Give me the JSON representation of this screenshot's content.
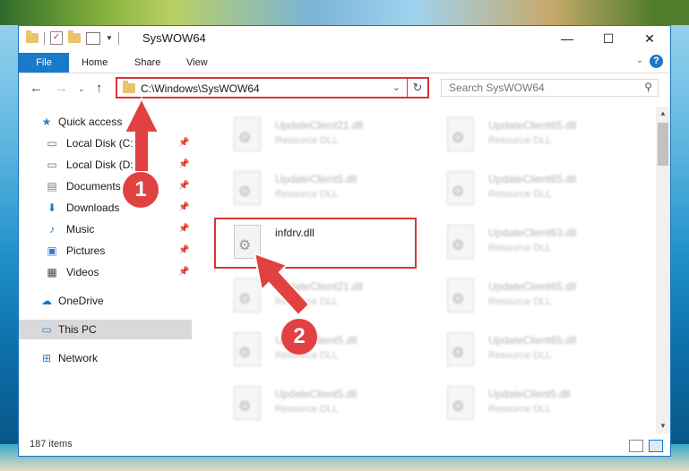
{
  "window": {
    "title": "SysWOW64",
    "minimize": "—",
    "maximize": "☐",
    "close": "✕"
  },
  "ribbon": {
    "tabs": [
      "File",
      "Home",
      "Share",
      "View"
    ],
    "help": "?"
  },
  "nav": {
    "address": "C:\\Windows\\SysWOW64",
    "search_placeholder": "Search SysWOW64"
  },
  "sidebar": {
    "items": [
      {
        "label": "Quick access",
        "icon": "star-icon"
      },
      {
        "label": "Local Disk (C:)",
        "icon": "drive-icon",
        "pinned": true
      },
      {
        "label": "Local Disk (D:)",
        "icon": "drive-icon",
        "pinned": true
      },
      {
        "label": "Documents",
        "icon": "document-icon",
        "pinned": true
      },
      {
        "label": "Downloads",
        "icon": "download-icon",
        "pinned": true
      },
      {
        "label": "Music",
        "icon": "music-icon",
        "pinned": true
      },
      {
        "label": "Pictures",
        "icon": "pictures-icon",
        "pinned": true
      },
      {
        "label": "Videos",
        "icon": "videos-icon",
        "pinned": true
      },
      {
        "label": "OneDrive",
        "icon": "cloud-icon"
      },
      {
        "label": "This PC",
        "icon": "computer-icon",
        "selected": true
      },
      {
        "label": "Network",
        "icon": "network-icon"
      }
    ]
  },
  "files": [
    {
      "name": "UpdateClient21.dll",
      "type": "Resource DLL"
    },
    {
      "name": "UpdateClient65.dll",
      "type": "Resource DLL"
    },
    {
      "name": "UpdateClient5.dll",
      "type": "Resource DLL"
    },
    {
      "name": "UpdateClient65.dll",
      "type": "Resource DLL"
    },
    {
      "name": "infdrv.dll",
      "type": ""
    },
    {
      "name": "UpdateClient63.dll",
      "type": "Resource DLL"
    },
    {
      "name": "UpdateClient21.dll",
      "type": "Resource DLL"
    },
    {
      "name": "UpdateClient65.dll",
      "type": "Resource DLL"
    },
    {
      "name": "UpdateClient5.dll",
      "type": "Resource DLL"
    },
    {
      "name": "UpdateClient65.dll",
      "type": "Resource DLL"
    },
    {
      "name": "UpdateClient5.dll",
      "type": "Resource DLL"
    },
    {
      "name": "UpdateClient5.dll",
      "type": "Resource DLL"
    }
  ],
  "status": {
    "item_count": "187 items"
  },
  "annotations": {
    "step1": "1",
    "step2": "2"
  },
  "colors": {
    "accent": "#1979ca",
    "annotation": "#e14141"
  }
}
